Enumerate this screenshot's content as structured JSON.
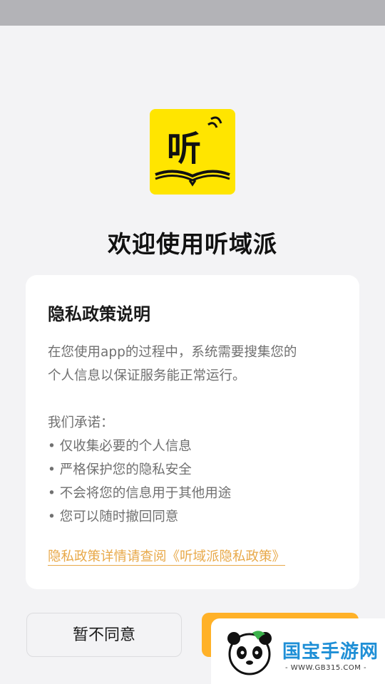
{
  "app": {
    "welcome_title": "欢迎使用听域派",
    "logo_icon": "listen-book-icon",
    "logo_char": "听"
  },
  "privacy_card": {
    "title": "隐私政策说明",
    "intro_line1": "在您使用app的过程中，系统需要搜集您的",
    "intro_line2": "个人信息以保证服务能正常运行。",
    "promise_heading": "我们承诺：",
    "promises": [
      "• 仅收集必要的个人信息",
      "• 严格保护您的隐私安全",
      "• 不会将您的信息用于其他用途",
      "• 您可以随时撤回同意"
    ],
    "policy_link": "隐私政策详情请查阅《听域派隐私政策》"
  },
  "buttons": {
    "decline_label": "暂不同意"
  },
  "watermark": {
    "brand": "国宝手游网",
    "url": "- WWW.GB315.COM -"
  },
  "colors": {
    "logo_bg": "#ffe500",
    "accent": "#ffb128",
    "link": "#e8a94a",
    "status_bar": "#b3b3b7"
  }
}
